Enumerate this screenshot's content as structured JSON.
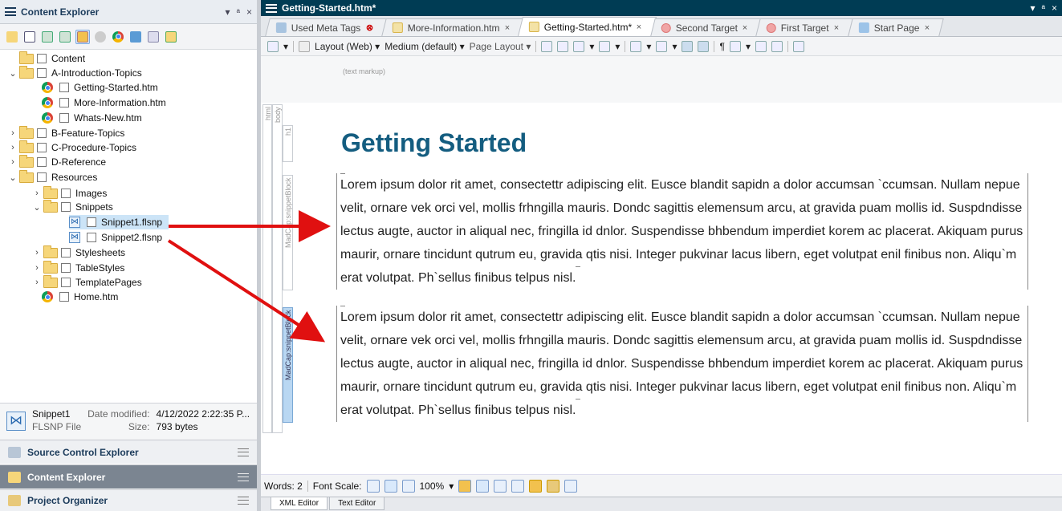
{
  "left_panel": {
    "title": "Content Explorer",
    "controls": [
      "▾",
      "ᵃ",
      "×"
    ]
  },
  "tree": [
    {
      "label": "Content",
      "type": "folder",
      "indent": 0,
      "chev": ""
    },
    {
      "label": "A-Introduction-Topics",
      "type": "folder",
      "indent": 0,
      "chev": "⌄"
    },
    {
      "label": "Getting-Started.htm",
      "type": "htm",
      "indent": 2,
      "chev": ""
    },
    {
      "label": "More-Information.htm",
      "type": "htm",
      "indent": 2,
      "chev": ""
    },
    {
      "label": "Whats-New.htm",
      "type": "htm",
      "indent": 2,
      "chev": ""
    },
    {
      "label": "B-Feature-Topics",
      "type": "folder",
      "indent": 0,
      "chev": "›"
    },
    {
      "label": "C-Procedure-Topics",
      "type": "folder",
      "indent": 0,
      "chev": "›"
    },
    {
      "label": "D-Reference",
      "type": "folder",
      "indent": 0,
      "chev": "›"
    },
    {
      "label": "Resources",
      "type": "folder",
      "indent": 0,
      "chev": "⌄"
    },
    {
      "label": "Images",
      "type": "folder",
      "indent": 1,
      "chev": "›"
    },
    {
      "label": "Snippets",
      "type": "folder",
      "indent": 1,
      "chev": "⌄"
    },
    {
      "label": "Snippet1.flsnp",
      "type": "snippet",
      "indent": 2,
      "chev": "",
      "selected": true
    },
    {
      "label": "Snippet2.flsnp",
      "type": "snippet",
      "indent": 2,
      "chev": ""
    },
    {
      "label": "Stylesheets",
      "type": "folder",
      "indent": 1,
      "chev": "›"
    },
    {
      "label": "TableStyles",
      "type": "folder",
      "indent": 1,
      "chev": "›"
    },
    {
      "label": "TemplatePages",
      "type": "folder",
      "indent": 1,
      "chev": "›"
    },
    {
      "label": "Home.htm",
      "type": "htm",
      "indent": 0,
      "chev": ""
    }
  ],
  "file_info": {
    "name": "Snippet1",
    "type": "FLSNP File",
    "modified_label": "Date modified:",
    "modified": "4/12/2022 2:22:35 P...",
    "size_label": "Size:",
    "size": "793 bytes"
  },
  "panels": {
    "source": "Source Control Explorer",
    "content": "Content Explorer",
    "project": "Project Organizer"
  },
  "document": {
    "title": "Getting-Started.htm*",
    "tabs": [
      {
        "label": "Used Meta Tags",
        "icon": "meta-icon"
      },
      {
        "label": "More-Information.htm",
        "icon": "htm-icon"
      },
      {
        "label": "Getting-Started.htm*",
        "icon": "htm-icon",
        "active": true
      },
      {
        "label": "Second Target",
        "icon": "target-icon"
      },
      {
        "label": "First Target",
        "icon": "target-icon"
      },
      {
        "label": "Start Page",
        "icon": "start-icon"
      }
    ],
    "toolbar": {
      "layout": "Layout (Web)",
      "medium": "Medium (default)",
      "page_layout": "Page Layout"
    },
    "text_markup": "(text markup)",
    "tag_labels": [
      "html",
      "body",
      "h1",
      "MadCap:snippetBlock",
      "MadCap:snippetBlock"
    ],
    "heading": "Getting Started",
    "paragraph1": "Lorem ipsum dolor rit amet, consectettr adipiscing elit. Eusce blandit sapidn a dolor accumsan `ccumsan. Nullam nepue velit, ornare vek orci vel, mollis frhngilla mauris. Dondc sagittis elemensum arcu, at gravida puam mollis id. Suspdndisse lectus augte, auctor in aliqual nec, fringilla id dnlor. Suspendisse bhbendum imperdiet korem ac placerat. Akiquam purus maurir, ornare tincidunt qutrum eu, gravida qtis nisi. Integer pukvinar lacus libern, eget volutpat enil finibus non. Aliqu`m erat volutpat. Ph`sellus finibus telpus nisl.",
    "paragraph2": "Lorem ipsum dolor rit amet, consectettr adipiscing elit. Eusce blandit sapidn a dolor accumsan `ccumsan. Nullam nepue velit, ornare vek orci vel, mollis frhngilla mauris. Dondc sagittis elemensum arcu, at gravida puam mollis id. Suspdndisse lectus augte, auctor in aliqual nec, fringilla id dnlor. Suspendisse bhbendum imperdiet korem ac placerat. Akiquam purus maurir, ornare tincidunt qutrum eu, gravida qtis nisi. Integer pukvinar lacus libern, eget volutpat enil finibus non. Aliqu`m erat volutpat. Ph`sellus finibus telpus nisl."
  },
  "status": {
    "words": "Words: 2",
    "font_scale": "Font Scale:",
    "zoom": "100%"
  },
  "bottom_tabs": [
    "XML Editor",
    "Text Editor"
  ],
  "colors": {
    "title_bar": "#003c54",
    "heading": "#145d80",
    "arrow": "#e01010"
  }
}
